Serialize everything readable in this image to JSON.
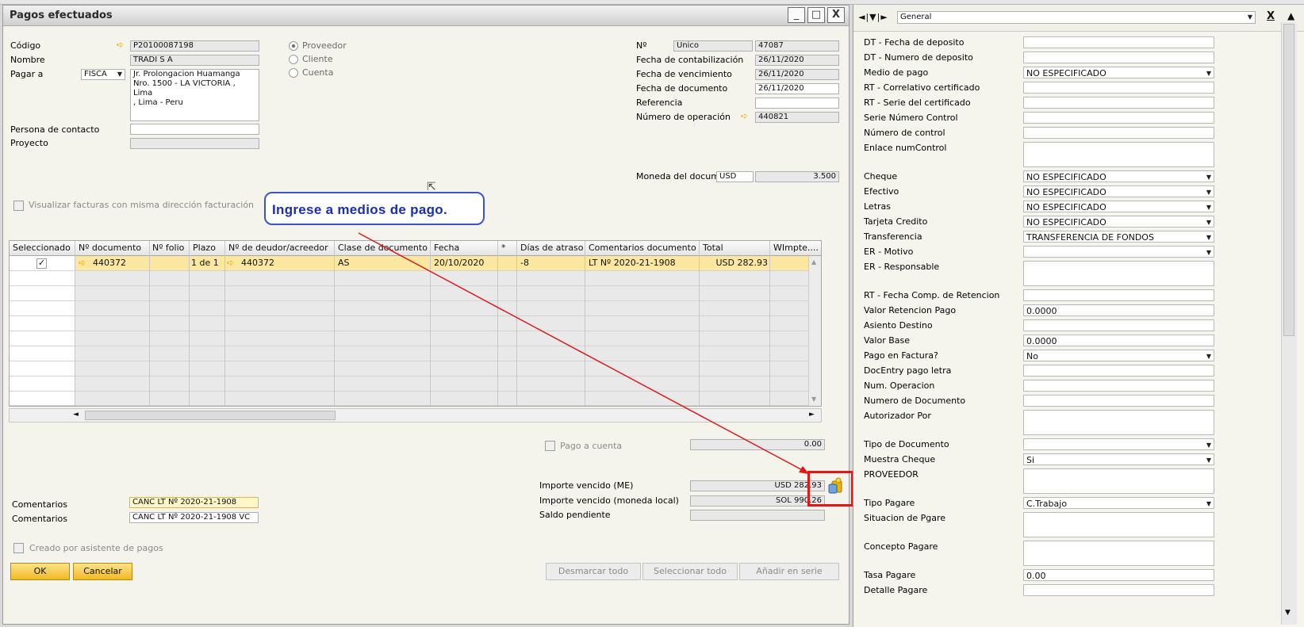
{
  "window": {
    "title": "Pagos efectuados",
    "min": "_",
    "max": "□",
    "close": "X"
  },
  "header_left": {
    "codigo_label": "Código",
    "codigo_value": "P20100087198",
    "nombre_label": "Nombre",
    "nombre_value": "TRADI S A",
    "pagar_label": "Pagar a",
    "pagar_select": "FISCA",
    "address": [
      "Jr. Prolongacion Huamanga",
      "Nro. 1500 - LA VICTORIA ,",
      "Lima",
      ", Lima - Peru"
    ],
    "contacto_label": "Persona de contacto",
    "proyecto_label": "Proyecto"
  },
  "radios": {
    "proveedor": "Proveedor",
    "cliente": "Cliente",
    "cuenta": "Cuenta"
  },
  "header_right": {
    "no_label": "Nº",
    "no_series": "Unico",
    "no_value": "47087",
    "fecha_cont_label": "Fecha de contabilización",
    "fecha_cont_value": "26/11/2020",
    "fecha_venc_label": "Fecha de vencimiento",
    "fecha_venc_value": "26/11/2020",
    "fecha_doc_label": "Fecha de documento",
    "fecha_doc_value": "26/11/2020",
    "referencia_label": "Referencia",
    "num_op_label": "Número de operación",
    "num_op_value": "440821",
    "moneda_label": "Moneda del docum",
    "moneda_value": "USD",
    "tc_value": "3.500"
  },
  "visualizar_label": "Visualizar facturas con misma dirección facturación",
  "callout_text": "Ingrese a medios de pago.",
  "grid": {
    "headers": [
      "Seleccionado",
      "Nº documento",
      "Nº folio",
      "Plazo",
      "Nº de deudor/acreedor",
      "Clase de documento",
      "Fecha",
      "*",
      "Días de atraso",
      "Comentarios documento",
      "Total",
      "WImpte...."
    ],
    "row": {
      "doc": "440372",
      "plazo": "1 de 1",
      "deudor": "440372",
      "clase": "AS",
      "fecha": "20/10/2020",
      "dias": "-8",
      "coment": "LT Nº 2020-21-1908",
      "total": "USD 282.93"
    }
  },
  "pago_cuenta_label": "Pago a cuenta",
  "pago_cuenta_value": "0.00",
  "importe_me_label": "Importe vencido (ME)",
  "importe_me_value": "USD 282.93",
  "importe_ml_label": "Importe vencido (moneda local)",
  "importe_ml_value": "SOL 990.26",
  "saldo_label": "Saldo pendiente",
  "comentarios_label": "Comentarios",
  "comentarios_value": "CANC LT Nº 2020-21-1908",
  "comentarios2_label": "Comentarios",
  "comentarios2_value": "CANC LT Nº 2020-21-1908 VC",
  "asistente_label": "Creado por asistente de pagos",
  "buttons": {
    "ok": "OK",
    "cancelar": "Cancelar",
    "desmarcar": "Desmarcar todo",
    "seleccionar": "Seleccionar todo",
    "anadir": "Añadir en serie"
  },
  "panel": {
    "nav": "◄|▼|►",
    "category": "General",
    "close": "X",
    "fields": [
      {
        "label": "DT - Fecha de deposito",
        "value": ""
      },
      {
        "label": "DT - Numero de deposito",
        "value": ""
      },
      {
        "label": "Medio de pago",
        "value": "NO ESPECIFICADO",
        "dd": true
      },
      {
        "label": "RT - Correlativo certificado",
        "value": ""
      },
      {
        "label": "RT - Serie del certificado",
        "value": ""
      },
      {
        "label": "Serie Número Control",
        "value": ""
      },
      {
        "label": "Número de control",
        "value": ""
      },
      {
        "label": "Enlace numControl",
        "value": "",
        "tall": true
      },
      {
        "label": "Cheque",
        "value": "NO ESPECIFICADO",
        "dd": true
      },
      {
        "label": "Efectivo",
        "value": "NO ESPECIFICADO",
        "dd": true
      },
      {
        "label": "Letras",
        "value": "NO ESPECIFICADO",
        "dd": true
      },
      {
        "label": "Tarjeta Credito",
        "value": "NO ESPECIFICADO",
        "dd": true
      },
      {
        "label": "Transferencia",
        "value": "TRANSFERENCIA DE FONDOS",
        "dd": true
      },
      {
        "label": "ER - Motivo",
        "value": "",
        "dd": true
      },
      {
        "label": "ER - Responsable",
        "value": "",
        "tall": true
      },
      {
        "label": "RT - Fecha Comp. de Retencion",
        "value": ""
      },
      {
        "label": "Valor Retencion Pago",
        "value": "0.0000"
      },
      {
        "label": "Asiento Destino",
        "value": ""
      },
      {
        "label": "Valor Base",
        "value": "0.0000"
      },
      {
        "label": "Pago en Factura?",
        "value": "No",
        "dd": true
      },
      {
        "label": "DocEntry pago letra",
        "value": ""
      },
      {
        "label": "Num. Operacion",
        "value": ""
      },
      {
        "label": "Numero de Documento",
        "value": ""
      },
      {
        "label": "Autorizador Por",
        "value": "",
        "tall": true
      },
      {
        "label": "Tipo de Documento",
        "value": "",
        "dd": true
      },
      {
        "label": "Muestra Cheque",
        "value": "Si",
        "dd": true
      },
      {
        "label": "PROVEEDOR",
        "value": "",
        "tall": true
      },
      {
        "label": "Tipo Pagare",
        "value": "C.Trabajo",
        "dd": true
      },
      {
        "label": "Situacion de Pgare",
        "value": "",
        "tall": true
      },
      {
        "label": "Concepto Pagare",
        "value": "",
        "tall": true
      },
      {
        "label": "Tasa Pagare",
        "value": "0.00"
      },
      {
        "label": "Detalle Pagare",
        "value": ""
      }
    ]
  }
}
